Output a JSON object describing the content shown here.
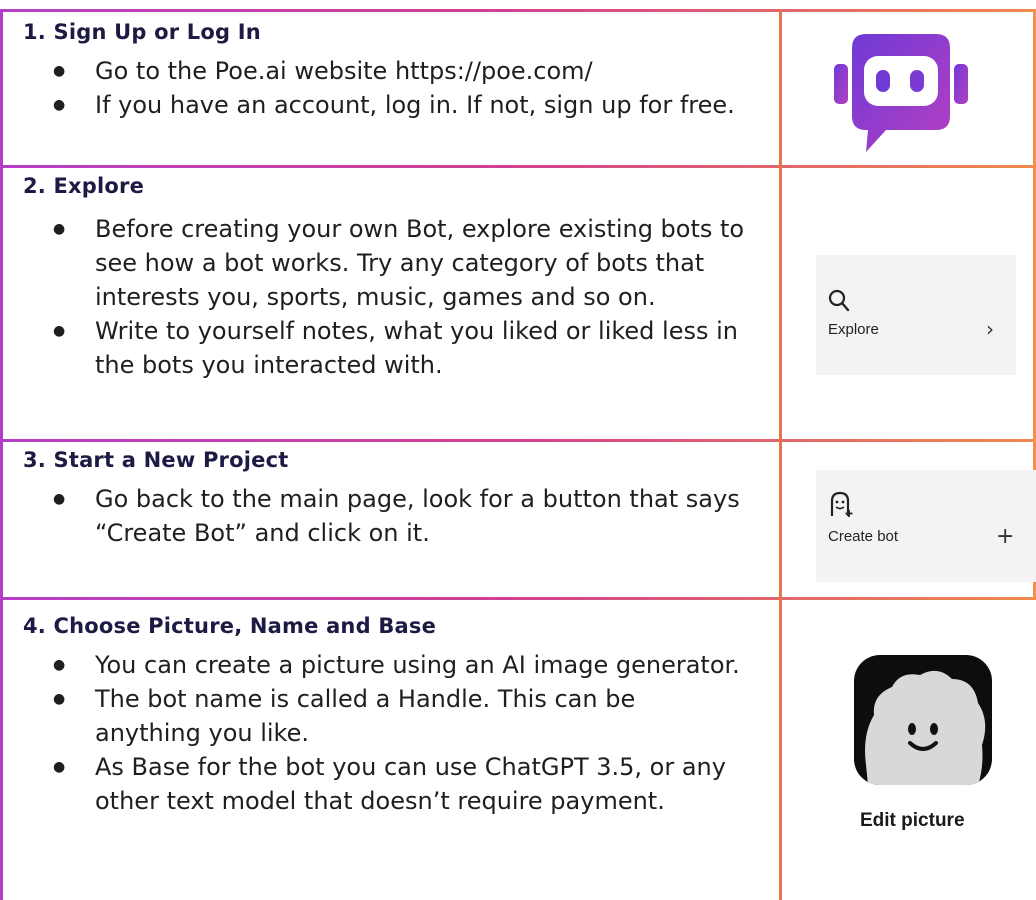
{
  "sections": [
    {
      "heading": "1. Sign Up or Log In",
      "bullets": [
        "Go to the Poe.ai website https://poe.com/",
        "If you have an account, log in. If not, sign up for free."
      ]
    },
    {
      "heading": "2. Explore",
      "bullets": [
        "Before creating your own Bot, explore existing bots to see how a bot works. Try any category of bots that interests you, sports, music, games and so on.",
        "Write to yourself notes, what you liked or liked less in the bots you interacted with."
      ],
      "image_label": "Explore"
    },
    {
      "heading": "3. Start a New Project",
      "bullets": [
        "Go back to the main page, look for a button that says “Create Bot” and click on it."
      ],
      "image_label": "Create bot"
    },
    {
      "heading": "4. Choose Picture, Name and Base",
      "bullets": [
        "You can create a picture using an AI image generator.",
        "The bot name is called a Handle.  This can be anything you like.",
        "As Base for the bot you can use ChatGPT 3.5, or any other text model that doesn’t require payment."
      ],
      "image_label": "Edit picture"
    }
  ],
  "colors": {
    "border_left": "#b43ec8",
    "border_right": "#ef8a4a",
    "heading": "#1d1b44",
    "poe_logo": "#8a3dd1"
  },
  "icons": [
    "poe-logo-icon",
    "search-icon",
    "chevron-right-icon",
    "create-bot-icon",
    "plus-icon",
    "avatar-icon"
  ]
}
